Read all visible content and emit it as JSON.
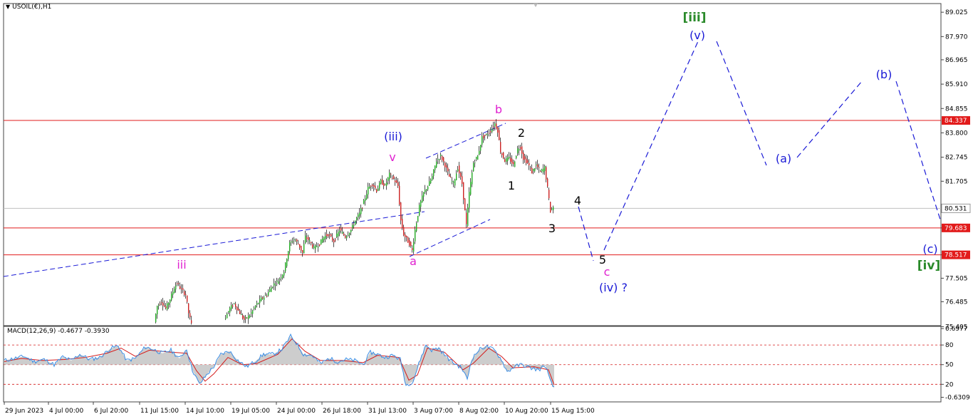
{
  "window": {
    "symbol_label": "USOIL(€),H1",
    "indicator_label": "MACD(12,26,9) -0.4677 -0.3930"
  },
  "colors": {
    "bull": "#22aa22",
    "bear": "#cc2222",
    "wick": "#222222",
    "hline": "#e21b1b",
    "wave_blue": "#1a1ad6",
    "wave_magenta": "#e020d0",
    "wave_green": "#2a8a2a",
    "wave_black": "#000000",
    "macd_line": "#3a8ee6",
    "macd_hist": "#c8c8c8",
    "signal": "#d41a1a"
  },
  "chart_data": [
    {
      "type": "candlestick",
      "title": "USOIL(€),H1",
      "ylim": [
        75.45,
        89.4
      ],
      "y_ticks": [
        "89.025",
        "87.970",
        "86.965",
        "85.910",
        "84.855",
        "83.800",
        "82.745",
        "81.705",
        "80.531",
        "79.683",
        "78.517",
        "77.505",
        "76.485",
        "75.405"
      ],
      "y_tick_values": [
        89.025,
        87.97,
        86.965,
        85.91,
        84.855,
        83.8,
        82.745,
        81.705,
        80.531,
        79.683,
        78.517,
        77.505,
        76.485,
        75.405
      ],
      "x_ticks": [
        "29 Jun 2023",
        "4 Jul 00:00",
        "6 Jul 20:00",
        "11 Jul 15:00",
        "14 Jul 10:00",
        "19 Jul 05:00",
        "24 Jul 00:00",
        "26 Jul 18:00",
        "31 Jul 13:00",
        "3 Aug 07:00",
        "8 Aug 02:00",
        "10 Aug 20:00",
        "15 Aug 15:00"
      ],
      "current_price": "80.531",
      "horizontal_levels": [
        {
          "label": "84.337",
          "value": 84.337
        },
        {
          "label": "79.683",
          "value": 79.683
        },
        {
          "label": "78.517",
          "value": 78.517
        }
      ],
      "price_path": [
        [
          218,
          75.6
        ],
        [
          222,
          76.3
        ],
        [
          228,
          76.5
        ],
        [
          234,
          76.2
        ],
        [
          240,
          76.6
        ],
        [
          246,
          77.1
        ],
        [
          250,
          77.3
        ],
        [
          256,
          77.0
        ],
        [
          262,
          76.8
        ],
        [
          266,
          76.0
        ],
        [
          270,
          75.5
        ],
        [
          280,
          75.2
        ],
        [
          300,
          75.3
        ],
        [
          316,
          75.7
        ],
        [
          324,
          76.2
        ],
        [
          330,
          76.4
        ],
        [
          336,
          76.1
        ],
        [
          344,
          75.7
        ],
        [
          352,
          75.9
        ],
        [
          360,
          76.3
        ],
        [
          368,
          76.6
        ],
        [
          376,
          76.8
        ],
        [
          384,
          77.2
        ],
        [
          392,
          77.4
        ],
        [
          400,
          77.8
        ],
        [
          404,
          78.4
        ],
        [
          408,
          79.0
        ],
        [
          414,
          79.2
        ],
        [
          420,
          79.0
        ],
        [
          426,
          78.6
        ],
        [
          430,
          79.3
        ],
        [
          436,
          79.1
        ],
        [
          442,
          78.8
        ],
        [
          450,
          79.0
        ],
        [
          456,
          79.3
        ],
        [
          462,
          79.4
        ],
        [
          470,
          79.1
        ],
        [
          478,
          79.6
        ],
        [
          486,
          79.3
        ],
        [
          494,
          79.6
        ],
        [
          500,
          80.0
        ],
        [
          506,
          80.3
        ],
        [
          512,
          80.8
        ],
        [
          518,
          81.4
        ],
        [
          524,
          81.6
        ],
        [
          530,
          81.3
        ],
        [
          536,
          81.7
        ],
        [
          542,
          81.5
        ],
        [
          548,
          82.0
        ],
        [
          554,
          81.8
        ],
        [
          560,
          81.5
        ],
        [
          564,
          80.0
        ],
        [
          568,
          79.4
        ],
        [
          572,
          79.2
        ],
        [
          576,
          79.0
        ],
        [
          580,
          78.7
        ],
        [
          584,
          79.6
        ],
        [
          590,
          80.6
        ],
        [
          596,
          81.2
        ],
        [
          602,
          81.5
        ],
        [
          608,
          81.9
        ],
        [
          614,
          82.6
        ],
        [
          620,
          82.8
        ],
        [
          626,
          82.4
        ],
        [
          632,
          81.9
        ],
        [
          638,
          81.6
        ],
        [
          644,
          82.3
        ],
        [
          650,
          81.6
        ],
        [
          656,
          79.8
        ],
        [
          660,
          81.2
        ],
        [
          666,
          82.5
        ],
        [
          672,
          82.8
        ],
        [
          678,
          83.6
        ],
        [
          684,
          83.7
        ],
        [
          690,
          83.9
        ],
        [
          696,
          84.2
        ],
        [
          700,
          83.9
        ],
        [
          704,
          83.0
        ],
        [
          710,
          82.6
        ],
        [
          716,
          82.7
        ],
        [
          722,
          82.4
        ],
        [
          728,
          83.1
        ],
        [
          732,
          83.2
        ],
        [
          736,
          82.7
        ],
        [
          742,
          82.5
        ],
        [
          748,
          82.1
        ],
        [
          754,
          82.4
        ],
        [
          760,
          82.1
        ],
        [
          766,
          82.3
        ],
        [
          770,
          81.4
        ],
        [
          774,
          80.4
        ],
        [
          778,
          80.6
        ]
      ]
    },
    {
      "type": "line",
      "title": "MACD(12,26,9) -0.4677 -0.3930",
      "y_ticks": [
        "0.6977",
        "80",
        "50",
        "20",
        "-0.6309"
      ],
      "y_tick_values": [
        0.6977,
        0.38,
        0.0,
        -0.38,
        -0.6309
      ],
      "ylim": [
        -0.72,
        0.74
      ],
      "x_ticks": [
        "29 Jun 2023",
        "4 Jul 00:00",
        "6 Jul 20:00",
        "11 Jul 15:00",
        "14 Jul 10:00",
        "19 Jul 05:00",
        "24 Jul 00:00",
        "26 Jul 18:00",
        "31 Jul 13:00",
        "3 Aug 07:00",
        "8 Aug 02:00",
        "10 Aug 20:00",
        "15 Aug 15:00"
      ],
      "macd_path": [
        [
          6,
          0.08
        ],
        [
          20,
          0.12
        ],
        [
          34,
          0.16
        ],
        [
          48,
          0.06
        ],
        [
          62,
          0.1
        ],
        [
          76,
          0.0
        ],
        [
          88,
          0.15
        ],
        [
          100,
          0.08
        ],
        [
          112,
          0.2
        ],
        [
          126,
          0.1
        ],
        [
          140,
          0.14
        ],
        [
          156,
          0.32
        ],
        [
          166,
          0.36
        ],
        [
          178,
          0.08
        ],
        [
          190,
          0.12
        ],
        [
          204,
          0.34
        ],
        [
          214,
          0.3
        ],
        [
          228,
          0.22
        ],
        [
          240,
          0.28
        ],
        [
          252,
          0.12
        ],
        [
          262,
          0.3
        ],
        [
          270,
          -0.1
        ],
        [
          280,
          -0.38
        ],
        [
          290,
          -0.2
        ],
        [
          300,
          -0.04
        ],
        [
          310,
          0.2
        ],
        [
          322,
          0.26
        ],
        [
          334,
          0.08
        ],
        [
          346,
          -0.04
        ],
        [
          358,
          0.06
        ],
        [
          370,
          0.2
        ],
        [
          384,
          0.2
        ],
        [
          396,
          0.3
        ],
        [
          408,
          0.55
        ],
        [
          416,
          0.42
        ],
        [
          426,
          0.2
        ],
        [
          438,
          0.18
        ],
        [
          450,
          0.02
        ],
        [
          462,
          0.12
        ],
        [
          474,
          0.06
        ],
        [
          486,
          0.1
        ],
        [
          498,
          0.08
        ],
        [
          510,
          0.0
        ],
        [
          520,
          0.24
        ],
        [
          530,
          0.2
        ],
        [
          540,
          0.14
        ],
        [
          552,
          0.18
        ],
        [
          562,
          0.1
        ],
        [
          570,
          -0.4
        ],
        [
          580,
          -0.32
        ],
        [
          590,
          0.1
        ],
        [
          598,
          0.38
        ],
        [
          606,
          0.28
        ],
        [
          616,
          0.32
        ],
        [
          626,
          0.16
        ],
        [
          636,
          0.04
        ],
        [
          648,
          -0.06
        ],
        [
          656,
          -0.28
        ],
        [
          662,
          0.1
        ],
        [
          672,
          0.28
        ],
        [
          682,
          0.36
        ],
        [
          694,
          0.28
        ],
        [
          704,
          0.1
        ],
        [
          712,
          -0.14
        ],
        [
          722,
          -0.04
        ],
        [
          732,
          0.0
        ],
        [
          744,
          -0.06
        ],
        [
          756,
          -0.1
        ],
        [
          766,
          -0.02
        ],
        [
          772,
          -0.3
        ],
        [
          778,
          -0.46
        ]
      ],
      "signal_path": [
        [
          6,
          0.06
        ],
        [
          30,
          0.12
        ],
        [
          60,
          0.08
        ],
        [
          90,
          0.1
        ],
        [
          120,
          0.14
        ],
        [
          150,
          0.22
        ],
        [
          170,
          0.32
        ],
        [
          190,
          0.16
        ],
        [
          210,
          0.28
        ],
        [
          240,
          0.24
        ],
        [
          262,
          0.22
        ],
        [
          276,
          -0.12
        ],
        [
          288,
          -0.32
        ],
        [
          300,
          -0.18
        ],
        [
          320,
          0.14
        ],
        [
          340,
          0.0
        ],
        [
          360,
          0.02
        ],
        [
          390,
          0.2
        ],
        [
          410,
          0.5
        ],
        [
          428,
          0.26
        ],
        [
          450,
          0.08
        ],
        [
          480,
          0.08
        ],
        [
          510,
          0.04
        ],
        [
          530,
          0.18
        ],
        [
          560,
          0.14
        ],
        [
          574,
          -0.3
        ],
        [
          586,
          -0.2
        ],
        [
          600,
          0.32
        ],
        [
          624,
          0.24
        ],
        [
          650,
          -0.1
        ],
        [
          664,
          0.02
        ],
        [
          686,
          0.32
        ],
        [
          704,
          0.16
        ],
        [
          720,
          -0.06
        ],
        [
          750,
          -0.04
        ],
        [
          770,
          -0.1
        ],
        [
          778,
          -0.39
        ]
      ]
    }
  ],
  "wave_labels": [
    {
      "text": "[iii]",
      "color_key": "wave_green",
      "x": 975,
      "y": 30,
      "size": 17
    },
    {
      "text": "(v)",
      "color_key": "wave_blue",
      "x": 979,
      "y": 55,
      "size": 16
    },
    {
      "text": "(b)",
      "color_key": "wave_blue",
      "x": 1241,
      "y": 110,
      "size": 16
    },
    {
      "text": "(a)",
      "color_key": "wave_blue",
      "x": 1100,
      "y": 228,
      "size": 16
    },
    {
      "text": "(c)",
      "color_key": "wave_blue",
      "x": 1306,
      "y": 355,
      "size": 16
    },
    {
      "text": "[iv]",
      "color_key": "wave_green",
      "x": 1304,
      "y": 378,
      "size": 17
    },
    {
      "text": "b",
      "color_key": "wave_magenta",
      "x": 700,
      "y": 159,
      "size": 16
    },
    {
      "text": "(iii)",
      "color_key": "wave_blue",
      "x": 552,
      "y": 197,
      "size": 16
    },
    {
      "text": "v",
      "color_key": "wave_magenta",
      "x": 551,
      "y": 226,
      "size": 16
    },
    {
      "text": "2",
      "color_key": "wave_black",
      "x": 732,
      "y": 192,
      "size": 16
    },
    {
      "text": "1",
      "color_key": "wave_black",
      "x": 718,
      "y": 266,
      "size": 16
    },
    {
      "text": "4",
      "color_key": "wave_black",
      "x": 811,
      "y": 287,
      "size": 16
    },
    {
      "text": "3",
      "color_key": "wave_black",
      "x": 775,
      "y": 326,
      "size": 16
    },
    {
      "text": "5",
      "color_key": "wave_black",
      "x": 846,
      "y": 370,
      "size": 16
    },
    {
      "text": "c",
      "color_key": "wave_magenta",
      "x": 852,
      "y": 387,
      "size": 16
    },
    {
      "text": "(iv) ?",
      "color_key": "wave_blue",
      "x": 861,
      "y": 409,
      "size": 16
    },
    {
      "text": "a",
      "color_key": "wave_magenta",
      "x": 580,
      "y": 372,
      "size": 16
    },
    {
      "text": "iii",
      "color_key": "wave_magenta",
      "x": 255,
      "y": 377,
      "size": 16
    }
  ]
}
